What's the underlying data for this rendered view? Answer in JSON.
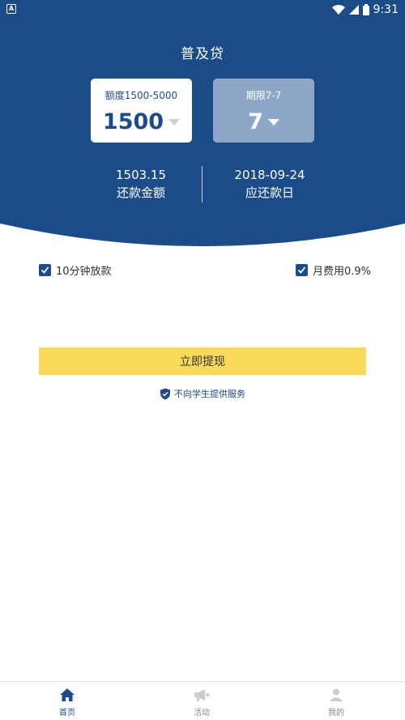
{
  "status_bar": {
    "time": "9:31",
    "notification_glyph": "A"
  },
  "header": {
    "title": "普及贷"
  },
  "amount_card": {
    "label": "额度1500-5000",
    "value": "1500"
  },
  "term_card": {
    "label": "期限7-7",
    "value": "7"
  },
  "summary": {
    "repay_amount_value": "1503.15",
    "repay_amount_label": "还款金额",
    "repay_date_value": "2018-09-24",
    "repay_date_label": "应还款日"
  },
  "options": {
    "fast_loan_label": "10分钟放款",
    "monthly_fee_label": "月费用0.9%"
  },
  "cta": {
    "label": "立即提现"
  },
  "notice": {
    "text": "不向学生提供服务"
  },
  "tabbar": {
    "items": [
      {
        "label": "首页",
        "icon": "home-icon"
      },
      {
        "label": "活动",
        "icon": "megaphone-icon"
      },
      {
        "label": "我的",
        "icon": "profile-icon"
      }
    ]
  },
  "colors": {
    "primary": "#1b4c89",
    "accent": "#fcd95a",
    "term_card_bg": "#8ea7c9"
  }
}
